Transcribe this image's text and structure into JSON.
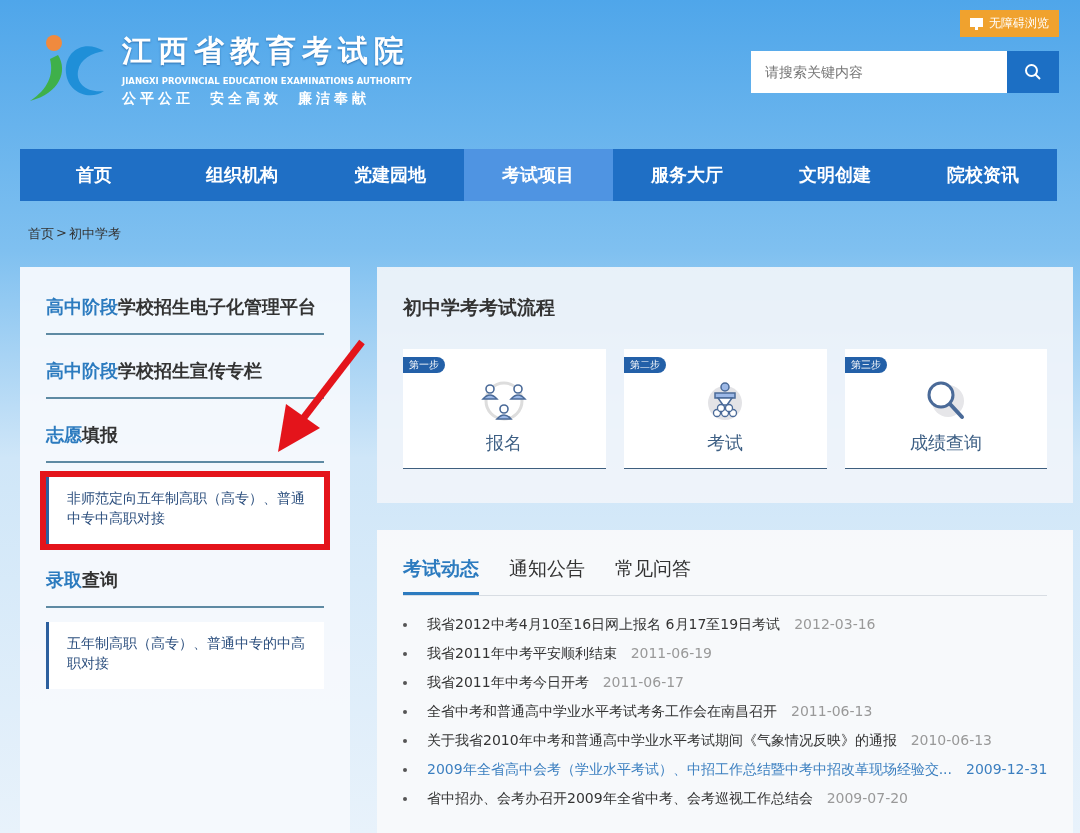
{
  "header": {
    "title": "江西省教育考试院",
    "subtitle": "JIANGXI PROVINCIAL EDUCATION EXAMINATIONS AUTHORITY",
    "motto": [
      "公平公正",
      "安全高效",
      "廉洁奉献"
    ],
    "accessibility_button": "无障碍浏览",
    "search": {
      "placeholder": "请搜索关键内容"
    }
  },
  "nav": [
    {
      "label": "首页",
      "selected": false
    },
    {
      "label": "组织机构",
      "selected": false
    },
    {
      "label": "党建园地",
      "selected": false
    },
    {
      "label": "考试项目",
      "selected": true
    },
    {
      "label": "服务大厅",
      "selected": false
    },
    {
      "label": "文明创建",
      "selected": false
    },
    {
      "label": "院校资讯",
      "selected": false
    }
  ],
  "breadcrumb": [
    "首页",
    ">",
    "初中学考"
  ],
  "sidebar": [
    {
      "highlight": "高中阶段",
      "rest": "学校招生电子化管理平台"
    },
    {
      "highlight": "高中阶段",
      "rest": "学校招生宣传专栏"
    },
    {
      "highlight": "志愿",
      "rest": "填报",
      "children": [
        {
          "label": "非师范定向五年制高职（高专）、普通中专中高职对接",
          "outlined": true
        }
      ]
    },
    {
      "highlight": "录取",
      "rest": "查询",
      "children": [
        {
          "label": "五年制高职（高专）、普通中专的中高职对接",
          "outlined": false
        }
      ]
    }
  ],
  "process": {
    "title": "初中学考考试流程",
    "steps": [
      {
        "badge": "第一步",
        "label": "报名",
        "kind": "people"
      },
      {
        "badge": "第二步",
        "label": "考试",
        "kind": "exam"
      },
      {
        "badge": "第三步",
        "label": "成绩查询",
        "kind": "search"
      }
    ]
  },
  "news": {
    "tabs": [
      {
        "label": "考试动态",
        "selected": true
      },
      {
        "label": "通知公告",
        "selected": false
      },
      {
        "label": "常见问答",
        "selected": false
      }
    ],
    "items": [
      {
        "title": "我省2012中考4月10至16日网上报名 6月17至19日考试",
        "date": "2012-03-16",
        "highlighted": false
      },
      {
        "title": "我省2011年中考平安顺利结束",
        "date": "2011-06-19",
        "highlighted": false
      },
      {
        "title": "我省2011年中考今日开考",
        "date": "2011-06-17",
        "highlighted": false
      },
      {
        "title": "全省中考和普通高中学业水平考试考务工作会在南昌召开",
        "date": "2011-06-13",
        "highlighted": false
      },
      {
        "title": "关于我省2010年中考和普通高中学业水平考试期间《气象情况反映》的通报",
        "date": "2010-06-13",
        "highlighted": false
      },
      {
        "title": "2009年全省高中会考（学业水平考试）、中招工作总结暨中考中招改革现场经验交...",
        "date": "2009-12-31",
        "highlighted": true
      },
      {
        "title": "省中招办、会考办召开2009年全省中考、会考巡视工作总结会",
        "date": "2009-07-20",
        "highlighted": false
      }
    ]
  }
}
